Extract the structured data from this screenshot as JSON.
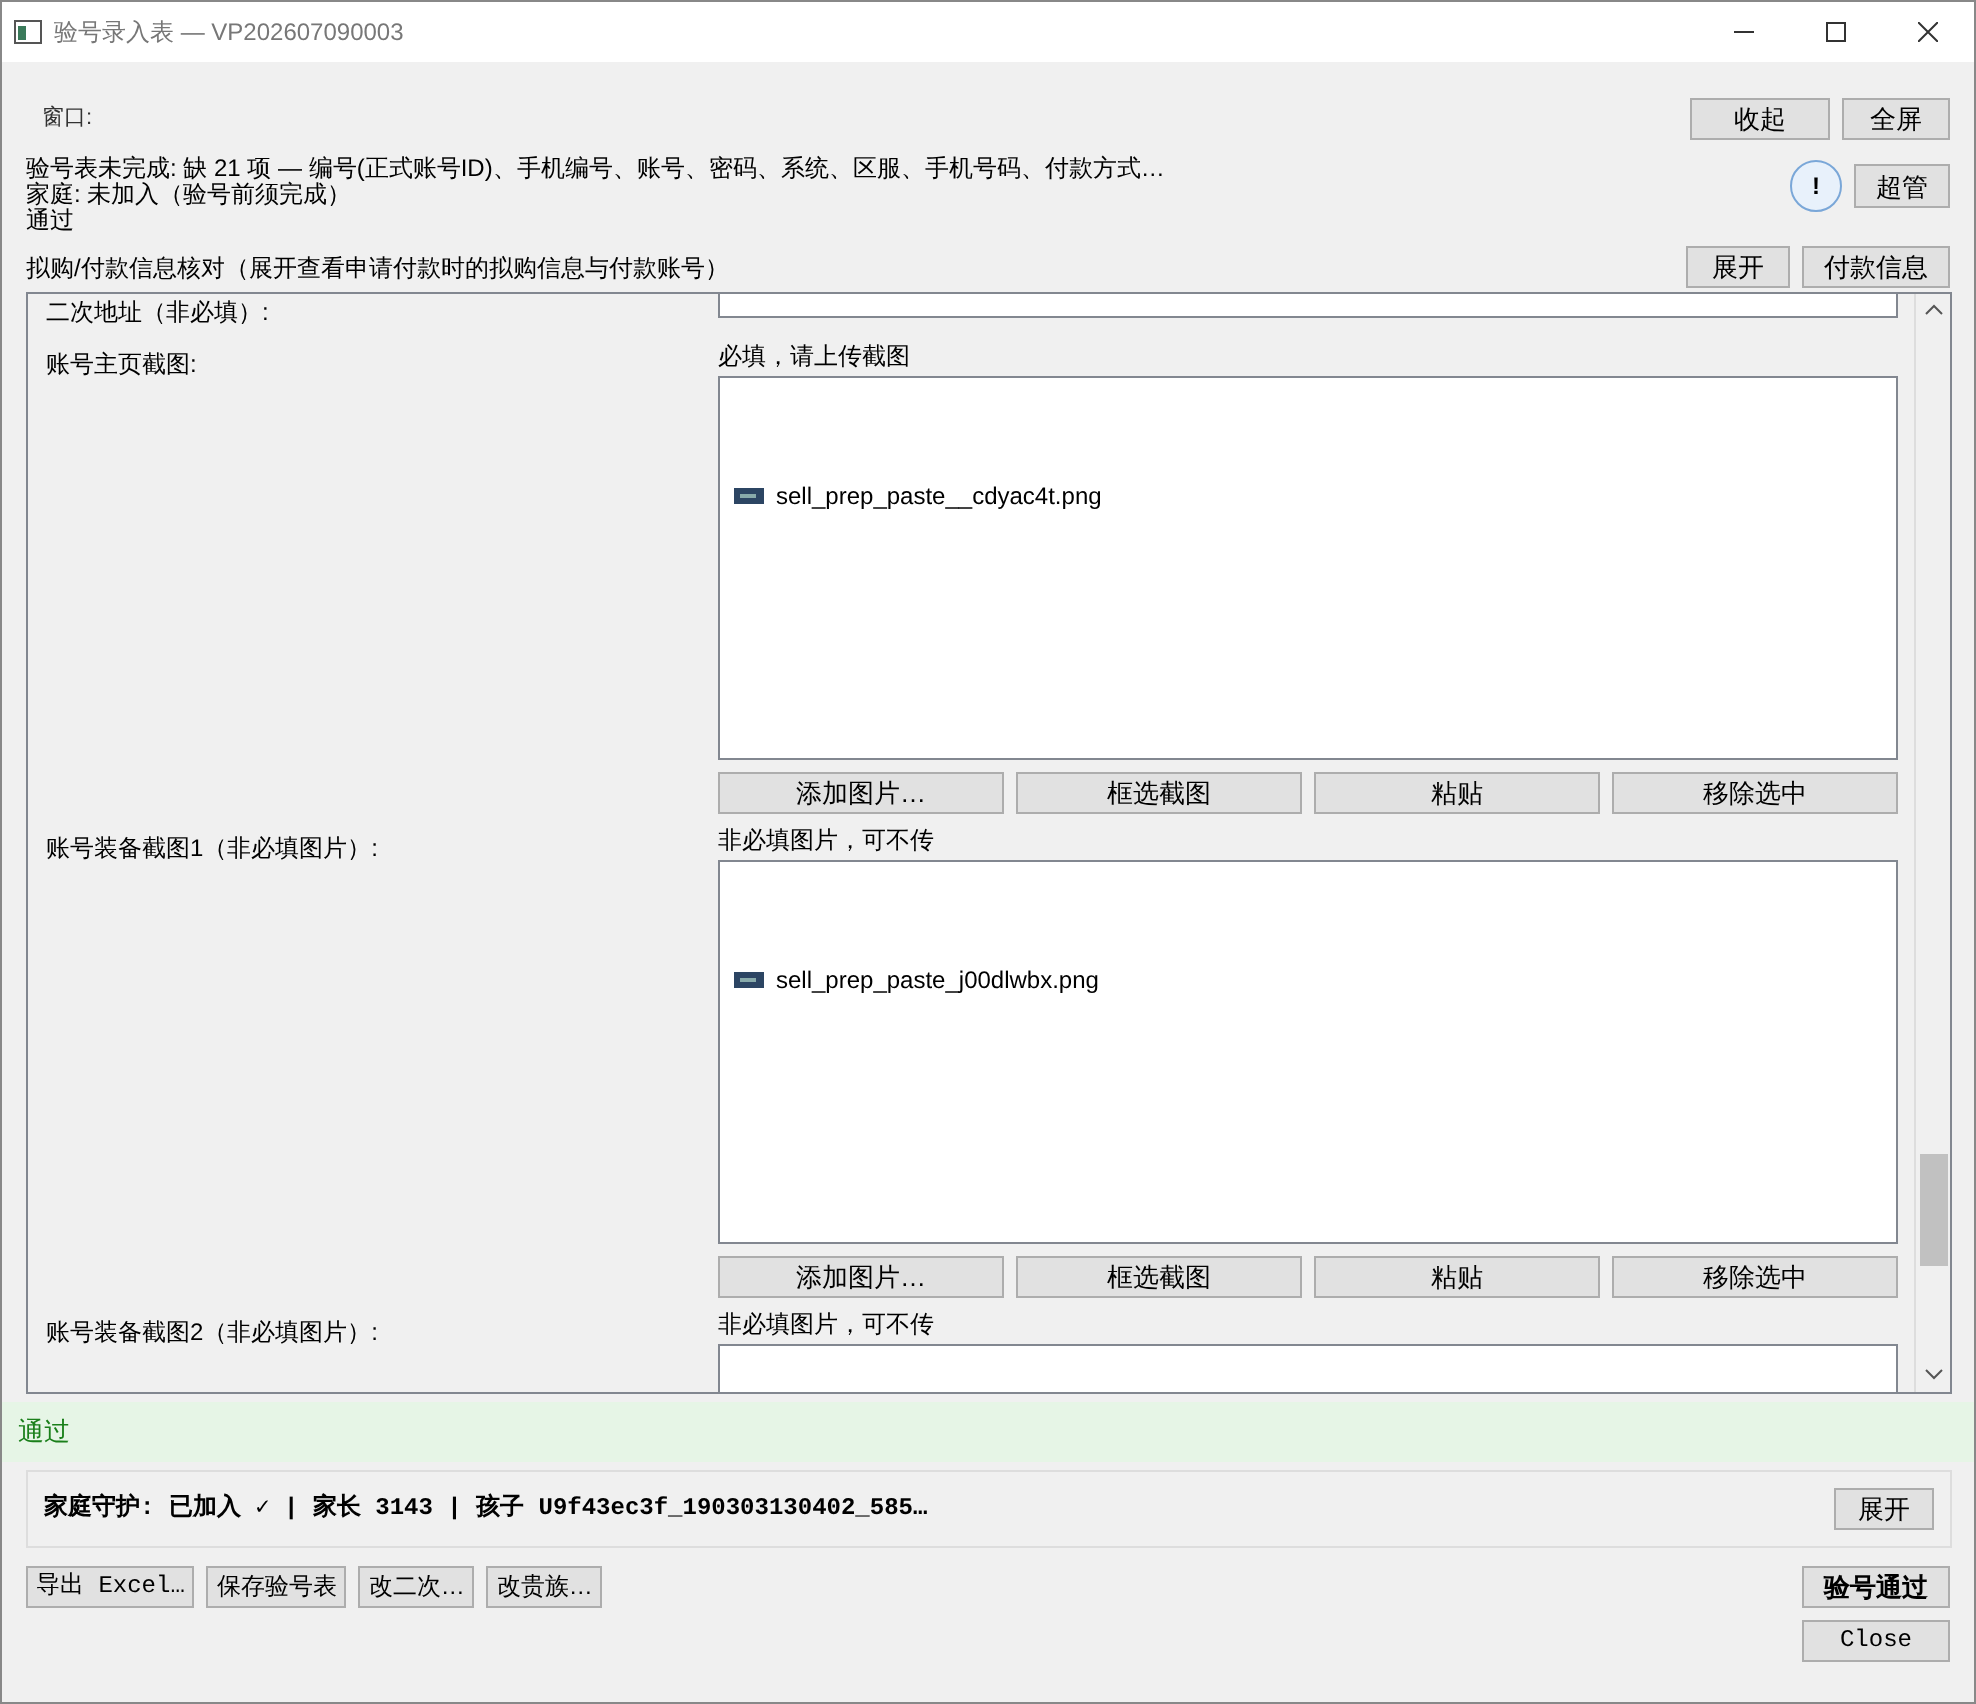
{
  "window": {
    "title": "验号录入表 — VP202607090003"
  },
  "header": {
    "label": "窗口:",
    "buttons": [
      "收起",
      "全屏"
    ]
  },
  "status": {
    "lines": [
      "验号表未完成: 缺 21 项 — 编号(正式账号ID)、手机编号、账号、密码、系统、区服、手机号码、付款方式…",
      "家庭: 未加入（验号前须完成）",
      "通过"
    ],
    "alert_icon": "!",
    "admin_button": "超管"
  },
  "payment": {
    "text": "拟购/付款信息核对（展开查看申请付款时的拟购信息与付款账号）",
    "buttons": [
      "展开",
      "付款信息"
    ]
  },
  "fields": [
    {
      "kind": "text",
      "label": "二次地址（非必填）:"
    },
    {
      "kind": "image",
      "label": "账号主页截图:",
      "hint": "必填，请上传截图",
      "files": [
        "sell_prep_paste__cdyac4t.png"
      ],
      "buttons": [
        "添加图片…",
        "框选截图",
        "粘贴",
        "移除选中"
      ]
    },
    {
      "kind": "image",
      "label": "账号装备截图1（非必填图片）:",
      "hint": "非必填图片，可不传",
      "files": [
        "sell_prep_paste_j00dlwbx.png"
      ],
      "buttons": [
        "添加图片…",
        "框选截图",
        "粘贴",
        "移除选中"
      ]
    },
    {
      "kind": "image",
      "label": "账号装备截图2（非必填图片）:",
      "hint": "非必填图片，可不传"
    }
  ],
  "result": "通过",
  "family": {
    "text": "家庭守护: 已加入 ✓ | 家长 3143 | 孩子 U9f43ec3f_190303130402_585…",
    "button": "展开"
  },
  "footer": {
    "buttons": [
      "导出 Excel…",
      "保存验号表",
      "改二次…",
      "改贵族…"
    ],
    "primary": "验号通过",
    "close": "Close"
  }
}
